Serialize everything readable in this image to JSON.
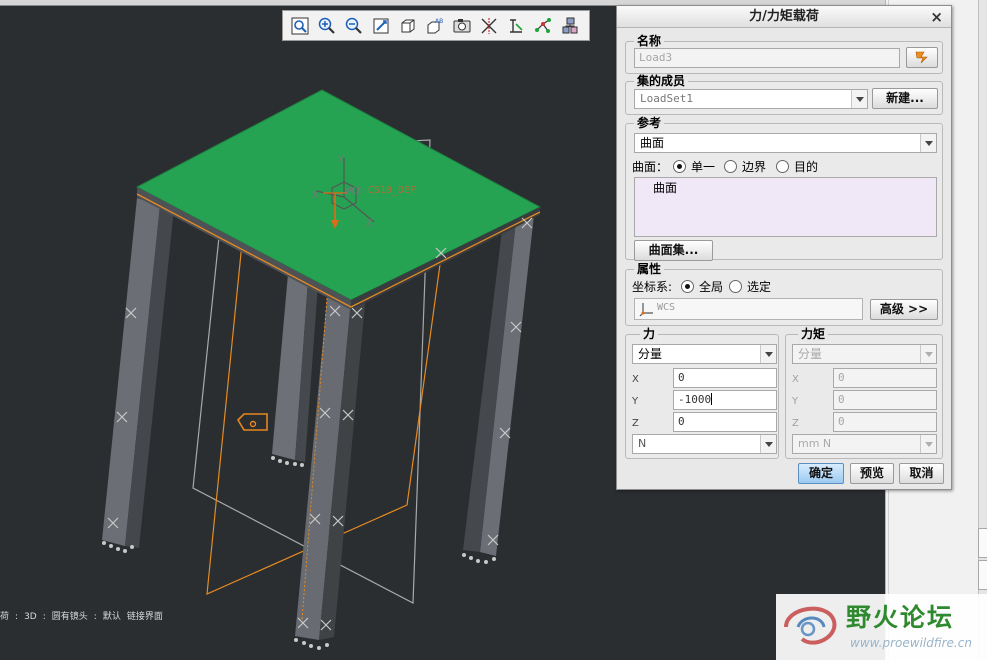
{
  "viewport": {
    "status": [
      "荷",
      ":",
      "3D",
      ":",
      "圆有镜头",
      ":",
      "默认",
      "链接界面"
    ],
    "wcs_label": "WCS",
    "csys_text": "CS10_DEF",
    "axis_x": "X",
    "axis_y": "Y",
    "axis_z": "Z",
    "colors": {
      "top_surface": "#26a352",
      "legs": "#5a5d63",
      "edges": "#e58b22",
      "background": "#2b2e31"
    }
  },
  "toolbar": {
    "icons": [
      "refit-icon",
      "zoom-in-icon",
      "zoom-out-icon",
      "repaint-icon",
      "view-orientation-icon",
      "named-views-icon",
      "saved-views-icon",
      "datum-plane-display-icon",
      "datum-axis-display-icon",
      "datum-point-display-icon",
      "csys-display-icon"
    ]
  },
  "dialog": {
    "title": "力/力矩载荷",
    "close_glyph": "×",
    "name_group": {
      "label": "名称",
      "value": "Load3"
    },
    "member_group": {
      "label": "集的成员",
      "value": "LoadSet1",
      "new_button": "新建..."
    },
    "reference_group": {
      "label": "参考",
      "type_value": "曲面",
      "row_label": "曲面：",
      "options": [
        "单一",
        "边界",
        "目的"
      ],
      "selected_index": 0,
      "list_items": [
        "曲面"
      ],
      "surface_set_button": "曲面集..."
    },
    "property_group": {
      "label": "属性",
      "csys_label": "坐标系:",
      "options": [
        "全局",
        "选定"
      ],
      "selected_index": 0,
      "csys_value": "WCS",
      "advanced_button": "高级 >>"
    },
    "force_group": {
      "label": "力",
      "mode": "分量",
      "x_label": "X",
      "x_value": "0",
      "y_label": "Y",
      "y_value": "-1000",
      "z_label": "Z",
      "z_value": "0",
      "unit": "N"
    },
    "moment_group": {
      "label": "力矩",
      "mode": "分量",
      "x_label": "X",
      "x_value": "0",
      "y_label": "Y",
      "y_value": "0",
      "z_label": "Z",
      "z_value": "0",
      "unit": "mm N"
    },
    "ok_button": "确定",
    "preview_button": "预览",
    "cancel_button": "取消"
  },
  "watermark": {
    "title": "野火论坛",
    "url": "www.proewildfire.cn"
  }
}
